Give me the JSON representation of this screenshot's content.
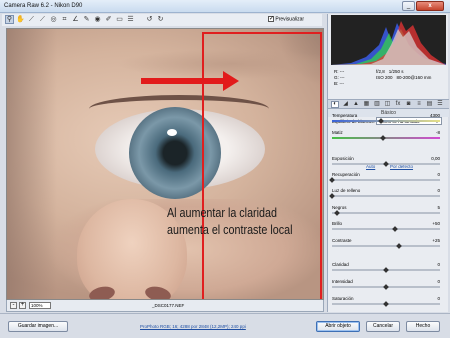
{
  "window": {
    "title": "Camera Raw 6.2 - Nikon D90",
    "minimize_glyph": "_",
    "close_glyph": "x"
  },
  "toolbar": {
    "tools": [
      "zoom-icon",
      "hand-icon",
      "eyedropper-icon",
      "color-sampler-icon",
      "target-adjust-icon",
      "crop-icon",
      "straighten-icon",
      "spot-removal-icon",
      "red-eye-icon",
      "adjustment-brush-icon",
      "graduated-filter-icon",
      "preferences-icon",
      "rotate-left-icon",
      "rotate-right-icon"
    ],
    "tool_glyphs": [
      "⚲",
      "✋",
      "⟋",
      "⟋",
      "◎",
      "⌗",
      "∠",
      "✎",
      "◉",
      "✐",
      "▭",
      "☰",
      "↺",
      "↻"
    ],
    "preview_label": "Previsualizar",
    "preview_checked": "✓"
  },
  "image": {
    "annotation_line1": "Al aumentar la claridad",
    "annotation_line2": "aumenta el contraste local",
    "highlight_color": "#e01f1f"
  },
  "statusbar": {
    "zoom_out": "-",
    "zoom_value": "100%",
    "zoom_in": "+",
    "filename": "_DSC0177.NEF"
  },
  "camera_info": {
    "r": "R:  ---",
    "g": "G:  ---",
    "b": "B:  ---",
    "aperture": "f/2,8",
    "shutter": "1/250 s",
    "iso": "ISO 200",
    "lens": "80-200@160 mm"
  },
  "panel": {
    "tab_icons": [
      "basic-icon",
      "tone-curve-icon",
      "detail-icon",
      "hsl-icon",
      "split-toning-icon",
      "lens-corrections-icon",
      "effects-icon",
      "camera-calibration-icon",
      "presets-icon",
      "snapshots-icon",
      "panel-menu-icon"
    ],
    "tab_glyphs": [
      "◐",
      "◢",
      "▲",
      "▦",
      "▥",
      "◫",
      "fx",
      "◙",
      "≡",
      "▤",
      "☰"
    ],
    "section_title": "Básico",
    "wb_label": "Equilibrio de blancos:",
    "wb_value": "Como se ha tomado",
    "wb_arrow": "▼",
    "auto_label": "Auto",
    "default_label": "Por defecto"
  },
  "sliders": [
    {
      "label": "Temperatura",
      "value": "4300",
      "level": 0.45,
      "track": "temp"
    },
    {
      "label": "Matiz",
      "value": "-8",
      "level": 0.47,
      "track": "tint"
    },
    {
      "label": "Exposición",
      "value": "0,00",
      "level": 0.5,
      "track": "plain"
    },
    {
      "label": "Recuperación",
      "value": "0",
      "level": 0.0,
      "track": "plain"
    },
    {
      "label": "Luz de relleno",
      "value": "0",
      "level": 0.0,
      "track": "plain"
    },
    {
      "label": "Negros",
      "value": "5",
      "level": 0.05,
      "track": "plain"
    },
    {
      "label": "Brillo",
      "value": "+50",
      "level": 0.58,
      "track": "plain"
    },
    {
      "label": "Contraste",
      "value": "+25",
      "level": 0.62,
      "track": "plain"
    },
    {
      "label": "Claridad",
      "value": "0",
      "level": 0.5,
      "track": "plain"
    },
    {
      "label": "Intensidad",
      "value": "0",
      "level": 0.5,
      "track": "plain"
    },
    {
      "label": "Saturación",
      "value": "0",
      "level": 0.5,
      "track": "plain"
    }
  ],
  "bottom": {
    "save_label": "Guardar imagen...",
    "workflow_label": "ProPhoto RGB; 16; 4288 por 2848 (12,2MP); 240 ppi",
    "open_label": "Abrir objeto",
    "cancel_label": "Cancelar",
    "done_label": "Hecho"
  }
}
